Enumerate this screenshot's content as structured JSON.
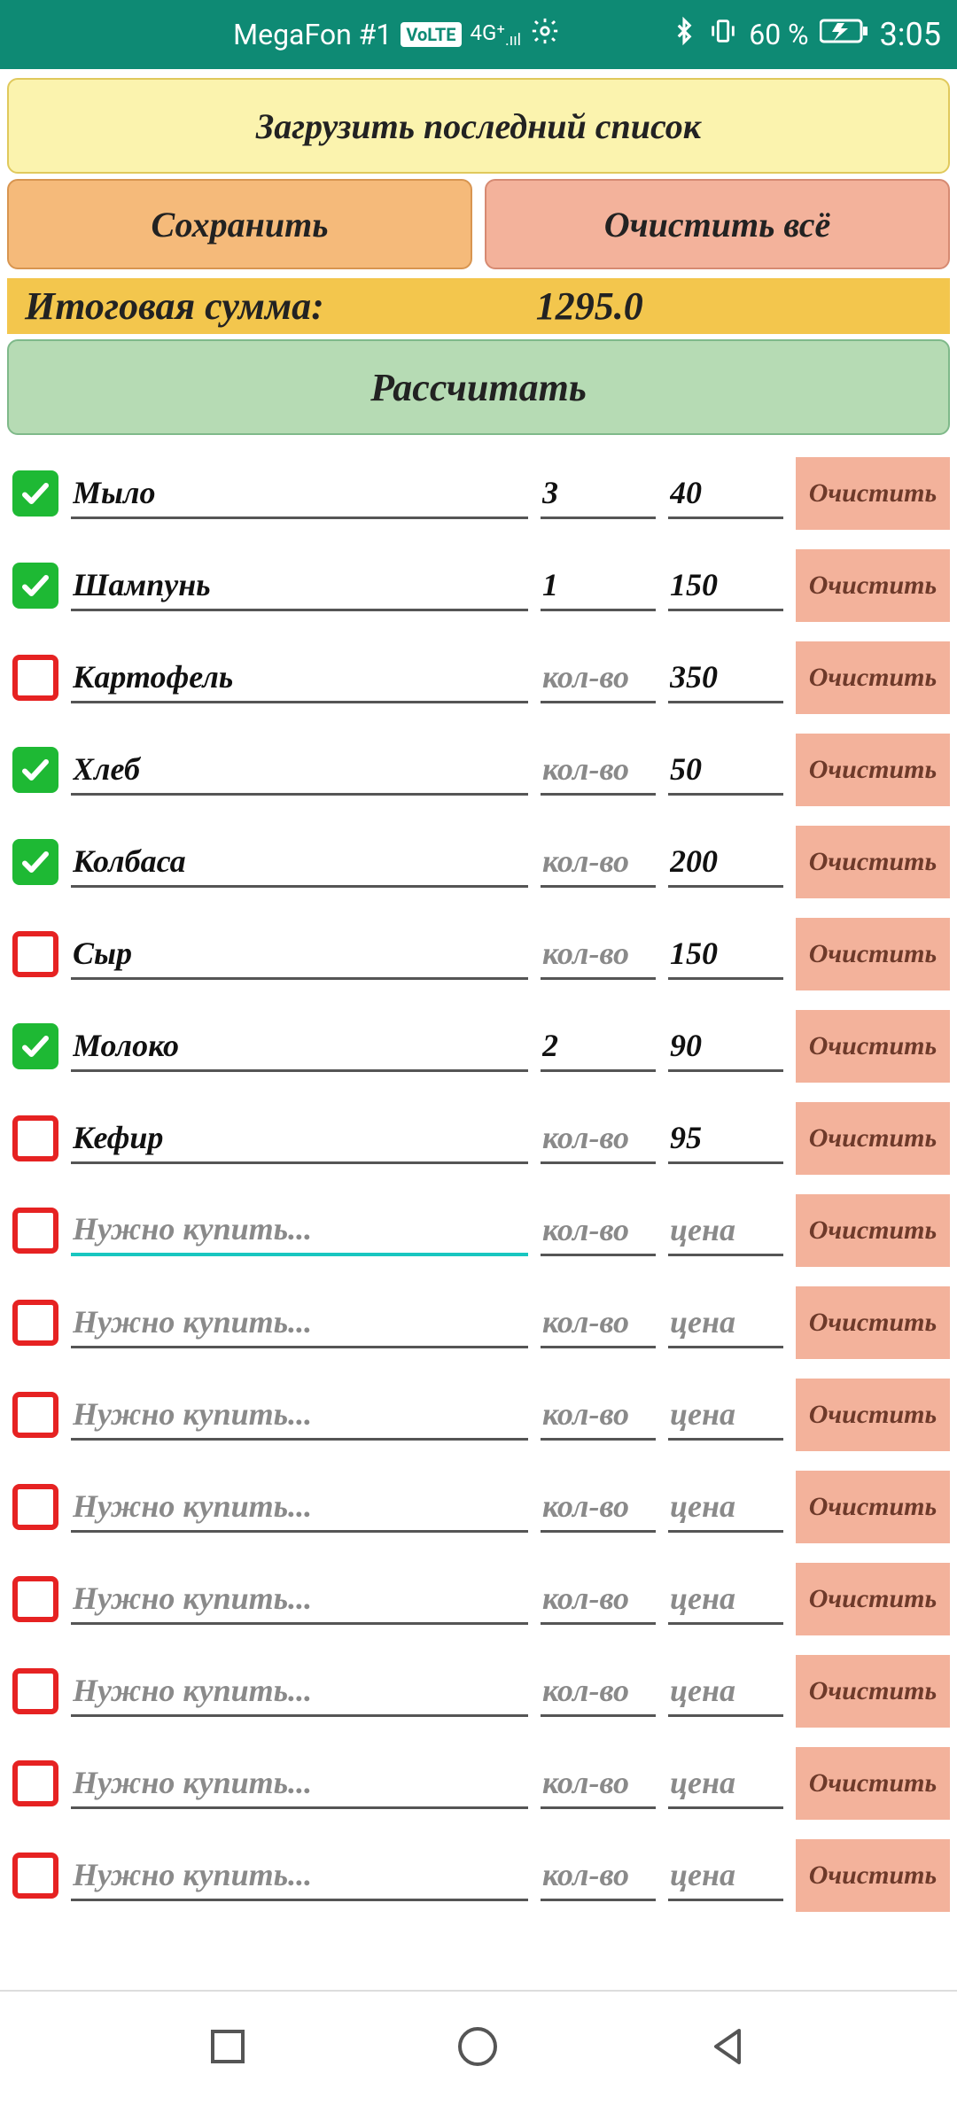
{
  "status": {
    "carrier": "MegaFon #1",
    "volte": "VoLTE",
    "network": "4G⁺",
    "battery": "60 %",
    "time": "3:05"
  },
  "buttons": {
    "load": "Загрузить последний список",
    "save": "Сохранить",
    "clear_all": "Очистить всё",
    "calculate": "Рассчитать",
    "clear_row": "Очистить"
  },
  "total": {
    "label": "Итоговая сумма:",
    "value": "1295.0"
  },
  "placeholders": {
    "name": "Нужно купить...",
    "qty": "кол-во",
    "price": "цена"
  },
  "items": [
    {
      "checked": true,
      "name": "Мыло",
      "qty": "3",
      "price": "40",
      "focused": false
    },
    {
      "checked": true,
      "name": "Шампунь",
      "qty": "1",
      "price": "150",
      "focused": false
    },
    {
      "checked": false,
      "name": "Картофель",
      "qty": "",
      "price": "350",
      "focused": false
    },
    {
      "checked": true,
      "name": "Хлеб",
      "qty": "",
      "price": "50",
      "focused": false
    },
    {
      "checked": true,
      "name": "Колбаса",
      "qty": "",
      "price": "200",
      "focused": false
    },
    {
      "checked": false,
      "name": "Сыр",
      "qty": "",
      "price": "150",
      "focused": false
    },
    {
      "checked": true,
      "name": "Молоко",
      "qty": "2",
      "price": "90",
      "focused": false
    },
    {
      "checked": false,
      "name": "Кефир",
      "qty": "",
      "price": "95",
      "focused": false
    },
    {
      "checked": false,
      "name": "",
      "qty": "",
      "price": "",
      "focused": true
    },
    {
      "checked": false,
      "name": "",
      "qty": "",
      "price": "",
      "focused": false
    },
    {
      "checked": false,
      "name": "",
      "qty": "",
      "price": "",
      "focused": false
    },
    {
      "checked": false,
      "name": "",
      "qty": "",
      "price": "",
      "focused": false
    },
    {
      "checked": false,
      "name": "",
      "qty": "",
      "price": "",
      "focused": false
    },
    {
      "checked": false,
      "name": "",
      "qty": "",
      "price": "",
      "focused": false
    },
    {
      "checked": false,
      "name": "",
      "qty": "",
      "price": "",
      "focused": false
    },
    {
      "checked": false,
      "name": "",
      "qty": "",
      "price": "",
      "focused": false
    }
  ]
}
